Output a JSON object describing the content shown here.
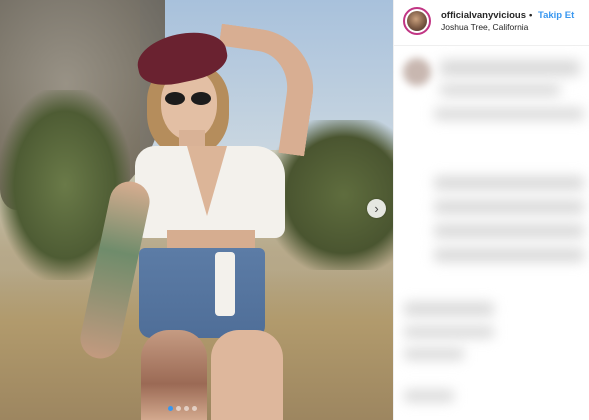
{
  "post": {
    "username": "officialvanyvicious",
    "separator": "•",
    "follow_label": "Takip Et",
    "location": "Joshua Tree, California"
  },
  "carousel": {
    "next_icon": "chevron-right-icon",
    "next_glyph": "›",
    "slide_count": 4,
    "active_slide": 1
  },
  "colors": {
    "follow_link": "#3897f0",
    "story_ring": "#c13584",
    "active_dot": "#3897f0"
  }
}
